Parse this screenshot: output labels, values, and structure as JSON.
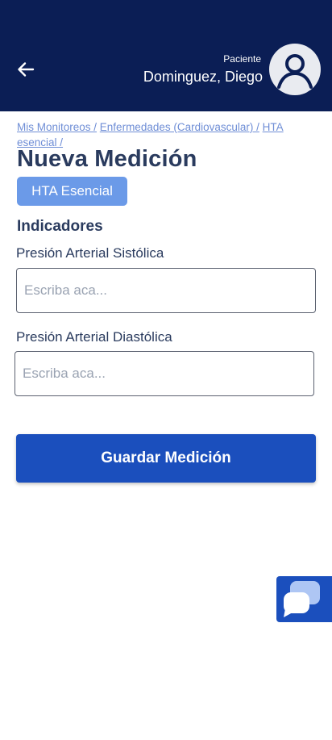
{
  "header": {
    "patient_label": "Paciente",
    "patient_name": "Dominguez, Diego",
    "colors": {
      "background": "#0b1e55",
      "text": "#ffffff"
    },
    "icons": {
      "back": "arrow-left-icon",
      "avatar": "user-icon"
    }
  },
  "breadcrumb": {
    "items": [
      "Mis Monitoreos /",
      "Enfermedades (Cardiovascular) /",
      "HTA esencial /"
    ]
  },
  "page": {
    "title": "Nueva Medición",
    "tag": "HTA Esencial"
  },
  "form": {
    "section_title": "Indicadores",
    "fields": [
      {
        "label": "Presión Arterial Sistólica",
        "placeholder": "Escriba aca...",
        "value": ""
      },
      {
        "label": "Presión Arterial Diastólica",
        "placeholder": "Escriba aca...",
        "value": ""
      }
    ],
    "submit_label": "Guardar Medición"
  },
  "chat": {
    "icon": "chat-bubble-icon"
  },
  "colors": {
    "primary": "#1b4fbd",
    "tag": "#6b9ae8",
    "link": "#6f8ed6",
    "heading": "#2a3b5e"
  }
}
